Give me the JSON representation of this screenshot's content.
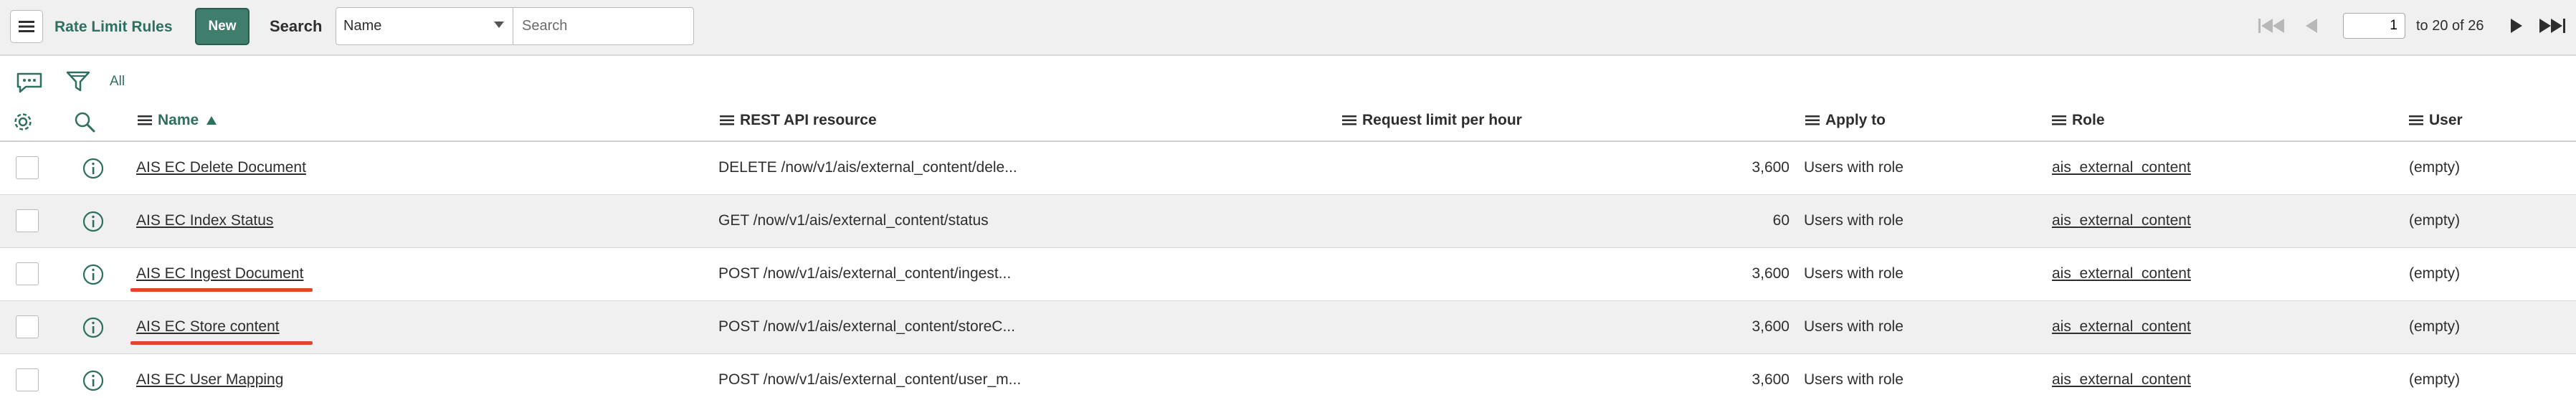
{
  "header": {
    "title": "Rate Limit Rules",
    "new_label": "New",
    "search_label": "Search",
    "search_field": "Name",
    "search_placeholder": "Search",
    "page_number": "1",
    "page_total": "to 20 of 26"
  },
  "filter": {
    "all_label": "All"
  },
  "columns": {
    "name": "Name",
    "resource": "REST API resource",
    "limit": "Request limit per hour",
    "apply": "Apply to",
    "role": "Role",
    "user": "User"
  },
  "rows": [
    {
      "name": "AIS EC Delete Document",
      "resource": "DELETE /now/v1/ais/external_content/dele...",
      "limit": "3,600",
      "apply": "Users with role",
      "role": "ais_external_content",
      "user": "(empty)"
    },
    {
      "name": "AIS EC Index Status",
      "resource": "GET /now/v1/ais/external_content/status",
      "limit": "60",
      "apply": "Users with role",
      "role": "ais_external_content",
      "user": "(empty)"
    },
    {
      "name": "AIS EC Ingest Document",
      "resource": "POST /now/v1/ais/external_content/ingest...",
      "limit": "3,600",
      "apply": "Users with role",
      "role": "ais_external_content",
      "user": "(empty)"
    },
    {
      "name": "AIS EC Store content",
      "resource": "POST /now/v1/ais/external_content/storeC...",
      "limit": "3,600",
      "apply": "Users with role",
      "role": "ais_external_content",
      "user": "(empty)"
    },
    {
      "name": "AIS EC User Mapping",
      "resource": "POST /now/v1/ais/external_content/user_m...",
      "limit": "3,600",
      "apply": "Users with role",
      "role": "ais_external_content",
      "user": "(empty)"
    }
  ],
  "colors": {
    "accent": "#2e7060",
    "new_button": "#3f7d6d",
    "annotation": "#e2452c"
  }
}
